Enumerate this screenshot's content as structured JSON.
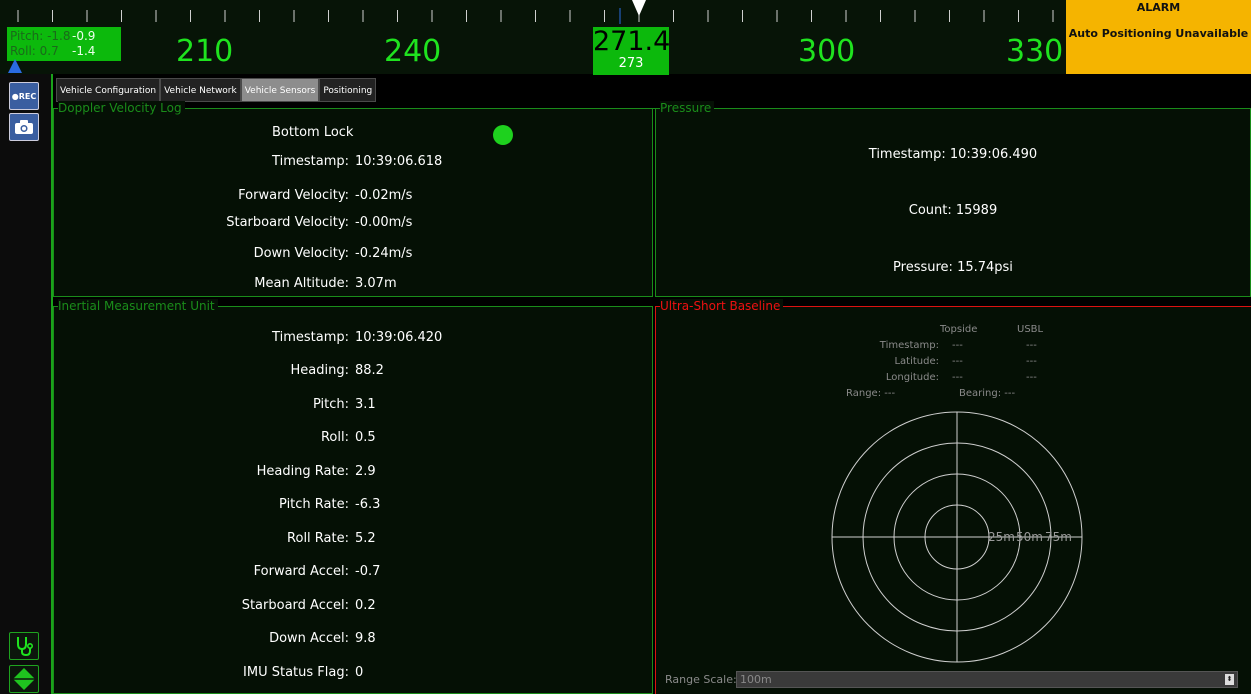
{
  "heading_tape": {
    "labels": [
      "210",
      "240",
      "300",
      "330"
    ],
    "current": "271.4",
    "target": "273"
  },
  "attitude": {
    "pitch_label": "Pitch: -1.8",
    "pitch_value": "-0.9",
    "roll_label": "Roll: 0.7",
    "roll_value": "-1.4"
  },
  "alarm": {
    "title": "ALARM",
    "message": "Auto Positioning Unavailable"
  },
  "toolbar": {
    "rec_label": "●REC"
  },
  "tabs": [
    {
      "label": "Vehicle Configuration"
    },
    {
      "label": "Vehicle Network"
    },
    {
      "label": "Vehicle Sensors",
      "active": true
    },
    {
      "label": "Positioning"
    }
  ],
  "dvl": {
    "title": "Doppler Velocity Log",
    "bottom_lock_label": "Bottom Lock",
    "rows": [
      {
        "label": "Timestamp:",
        "value": "10:39:06.618"
      },
      {
        "label": "Forward Velocity:",
        "value": "-0.02m/s"
      },
      {
        "label": "Starboard Velocity:",
        "value": "-0.00m/s"
      },
      {
        "label": "Down Velocity:",
        "value": "-0.24m/s"
      },
      {
        "label": "Mean Altitude:",
        "value": "3.07m"
      }
    ]
  },
  "pressure": {
    "title": "Pressure",
    "timestamp": "Timestamp: 10:39:06.490",
    "count": "Count: 15989",
    "pressure": "Pressure: 15.74psi"
  },
  "imu": {
    "title": "Inertial Measurement Unit",
    "rows": [
      {
        "label": "Timestamp:",
        "value": "10:39:06.420"
      },
      {
        "label": "Heading:",
        "value": "88.2"
      },
      {
        "label": "Pitch:",
        "value": "3.1"
      },
      {
        "label": "Roll:",
        "value": "0.5"
      },
      {
        "label": "Heading Rate:",
        "value": "2.9"
      },
      {
        "label": "Pitch Rate:",
        "value": "-6.3"
      },
      {
        "label": "Roll Rate:",
        "value": "5.2"
      },
      {
        "label": "Forward Accel:",
        "value": "-0.7"
      },
      {
        "label": "Starboard Accel:",
        "value": "0.2"
      },
      {
        "label": "Down Accel:",
        "value": "9.8"
      },
      {
        "label": "IMU Status Flag:",
        "value": "0"
      }
    ]
  },
  "usbl": {
    "title": "Ultra-Short Baseline",
    "col_topside": "Topside",
    "col_usbl": "USBL",
    "timestamp_label": "Timestamp:",
    "latitude_label": "Latitude:",
    "longitude_label": "Longitude:",
    "topside_timestamp": "---",
    "usbl_timestamp": "---",
    "topside_latitude": "---",
    "usbl_latitude": "---",
    "topside_longitude": "---",
    "usbl_longitude": "---",
    "range": "Range: ---",
    "bearing": "Bearing: ---",
    "ring_labels": [
      "25m",
      "50m",
      "75m"
    ],
    "range_scale_label": "Range Scale:",
    "range_scale_value": "100m"
  },
  "colors": {
    "accent_green": "#1fe31f",
    "panel_border": "#1a8c1a",
    "alarm_bg": "#f5b400",
    "usbl_alert": "#dd1111"
  },
  "icons": [
    "record-button-icon",
    "camera-icon",
    "stethoscope-icon",
    "navigation-arrows-icon"
  ]
}
